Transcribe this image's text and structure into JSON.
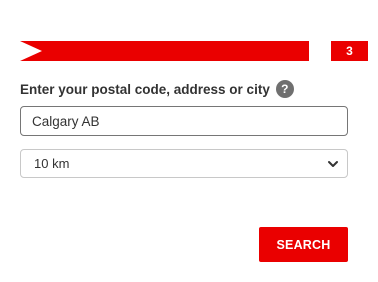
{
  "step": {
    "number": "3"
  },
  "location": {
    "label": "Enter your postal code, address or city",
    "help_icon": "question-mark-icon",
    "help_glyph": "?",
    "value": "Calgary AB"
  },
  "distance": {
    "selected": "10 km",
    "icon": "chevron-down-icon"
  },
  "actions": {
    "search_label": "SEARCH"
  },
  "colors": {
    "accent": "#ea0000",
    "help_icon": "#6f6f6f",
    "text": "#333333"
  }
}
